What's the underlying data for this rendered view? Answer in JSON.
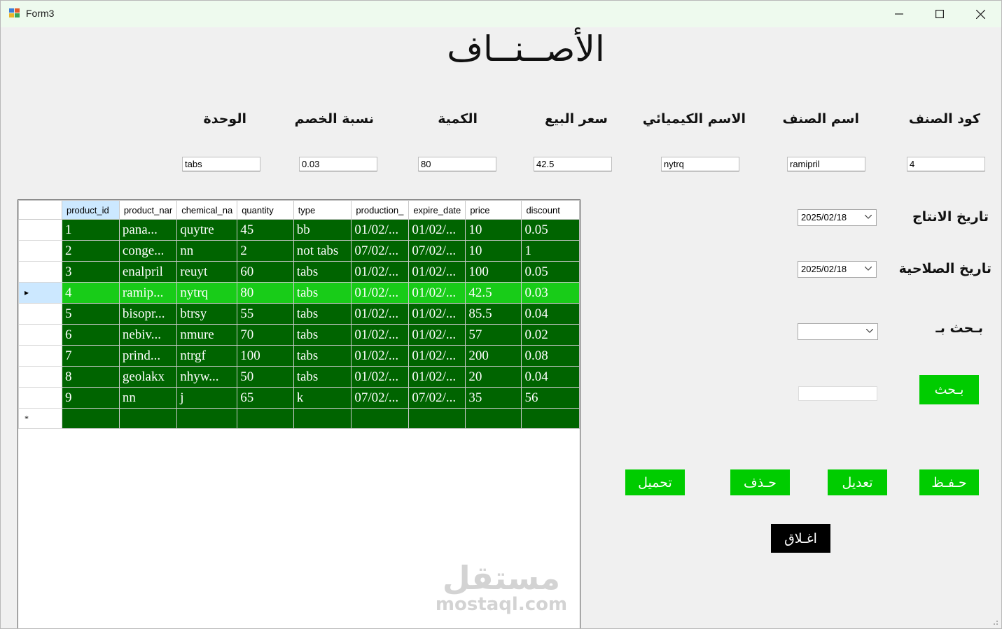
{
  "window": {
    "title": "Form3"
  },
  "heading": "الأصــنــاف",
  "fields": [
    {
      "key": "code",
      "label": "كود الصنف",
      "value": "4"
    },
    {
      "key": "name",
      "label": "اسم الصنف",
      "value": "ramipril"
    },
    {
      "key": "chemical",
      "label": "الاسم الكيميائي",
      "value": "nytrq"
    },
    {
      "key": "price",
      "label": "سعر البيع",
      "value": "42.5"
    },
    {
      "key": "quantity",
      "label": "الكمية",
      "value": "80"
    },
    {
      "key": "discount",
      "label": "نسبة الخصم",
      "value": "0.03"
    },
    {
      "key": "unit",
      "label": "الوحدة",
      "value": "tabs"
    }
  ],
  "dates": {
    "production_label": "تاريخ الانتاج",
    "production_value": "2025/02/18",
    "expiry_label": "تاريخ الصلاحية",
    "expiry_value": "2025/02/18"
  },
  "search": {
    "by_label": "بـحث بـ",
    "by_value": "",
    "input_value": "",
    "button_label": "بـحث"
  },
  "actions": {
    "save": "حـفـظ",
    "edit": "تعديل",
    "delete": "حـذف",
    "load": "تحميل",
    "close": "اغـلاق"
  },
  "grid": {
    "columns": [
      "product_id",
      "product_nar",
      "chemical_na",
      "quantity",
      "type",
      "production_",
      "expire_date",
      "price",
      "discount"
    ],
    "rows": [
      [
        "1",
        "pana...",
        "quytre",
        "45",
        "bb",
        "01/02/...",
        "01/02/...",
        "10",
        "0.05"
      ],
      [
        "2",
        "conge...",
        "nn",
        "2",
        "not tabs",
        "07/02/...",
        "07/02/...",
        "10",
        "1"
      ],
      [
        "3",
        "enalpril",
        "reuyt",
        "60",
        "tabs",
        "01/02/...",
        "01/02/...",
        "100",
        "0.05"
      ],
      [
        "4",
        "ramip...",
        "nytrq",
        "80",
        "tabs",
        "01/02/...",
        "01/02/...",
        "42.5",
        "0.03"
      ],
      [
        "5",
        "bisopr...",
        "btrsy",
        "55",
        "tabs",
        "01/02/...",
        "01/02/...",
        "85.5",
        "0.04"
      ],
      [
        "6",
        "nebiv...",
        "nmure",
        "70",
        "tabs",
        "01/02/...",
        "01/02/...",
        "57",
        "0.02"
      ],
      [
        "7",
        "prind...",
        "ntrgf",
        "100",
        "tabs",
        "01/02/...",
        "01/02/...",
        "200",
        "0.08"
      ],
      [
        "8",
        "geolakx",
        "nhyw...",
        "50",
        "tabs",
        "01/02/...",
        "01/02/...",
        "20",
        "0.04"
      ],
      [
        "9",
        "nn",
        "j",
        "65",
        "k",
        "07/02/...",
        "07/02/...",
        "35",
        "56"
      ]
    ],
    "current_row": 3,
    "current_marker": "▸",
    "new_row_marker": "*"
  },
  "watermark": {
    "arabic": "مستقل",
    "latin": "mostaql.com"
  },
  "colors": {
    "grid_row": "#006400",
    "grid_current_row": "#18cc18",
    "button_green": "#00cc00",
    "title_bar": "#eefaee"
  }
}
